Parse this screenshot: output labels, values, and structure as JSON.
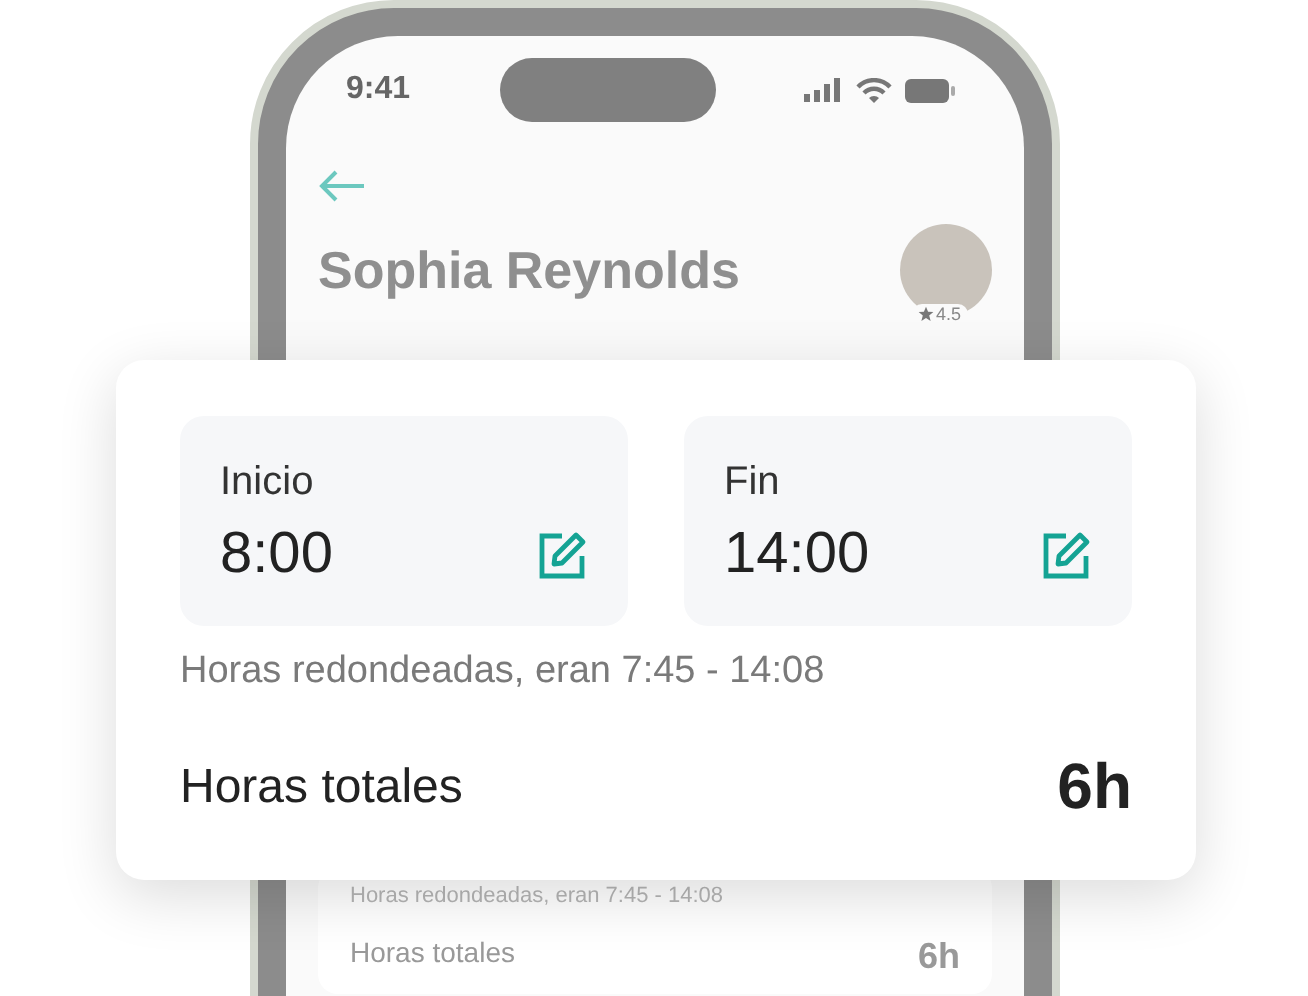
{
  "status_bar": {
    "time": "9:41"
  },
  "header": {
    "name": "Sophia Reynolds",
    "rating": "4.5"
  },
  "background_summary": {
    "note": "Horas redondeadas, eran 7:45 - 14:08",
    "total_label": "Horas totales",
    "total_value": "6h"
  },
  "card": {
    "fields": [
      {
        "label": "Inicio",
        "value": "8:00"
      },
      {
        "label": "Fin",
        "value": "14:00"
      }
    ],
    "note": "Horas redondeadas, eran 7:45 - 14:08",
    "total_label": "Horas totales",
    "total_value": "6h"
  }
}
